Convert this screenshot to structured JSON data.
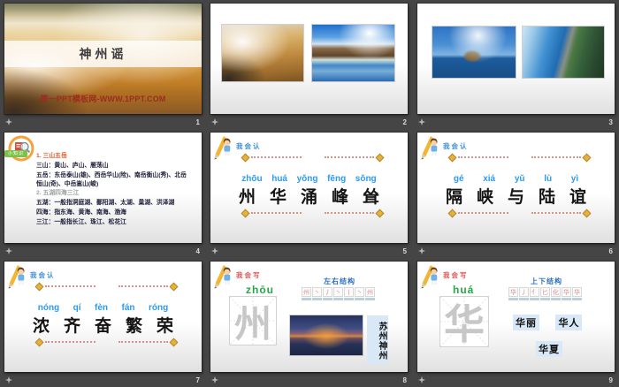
{
  "app": {
    "view": "slide-sorter"
  },
  "colors": {
    "canvas_gray": "#454545",
    "accent_blue": "#2b9bf0",
    "structure_blue": "#2a6fc0",
    "pinyin_green": "#2aa54a",
    "write_red": "#e05656",
    "read_blue": "#3b8ed8",
    "heading_orange": "#e2571f",
    "watermark_red": "#9b2d20",
    "tag_blue_bg": "#d9e8f6",
    "badge_green": "#7cc24a",
    "pushpin_gold": "#e5b23a"
  },
  "slides": [
    {
      "number": "1",
      "title": "神州谣",
      "watermark": "第一PPT模板网-WWW.1PPT.COM"
    },
    {
      "number": "2"
    },
    {
      "number": "3"
    },
    {
      "number": "4",
      "badge": "小知识",
      "lines": [
        {
          "style": "orange",
          "text": "1. 三山五岳"
        },
        {
          "style": "body",
          "text": "三山：黄山、庐山、雁荡山"
        },
        {
          "style": "body",
          "text": "五岳：东岳泰山(雄)、西岳华山(险)、南岳衡山(秀)、北岳恒山(奇)、中岳嵩山(峻)"
        },
        {
          "style": "gray",
          "text": "2. 五湖四海三江"
        },
        {
          "style": "body",
          "text": "五湖：一般指洞庭湖、鄱阳湖、太湖、巢湖、洪泽湖"
        },
        {
          "style": "body",
          "text": "四海：指东海、黄海、南海、渤海"
        },
        {
          "style": "body",
          "text": "三江：一般指长江、珠江、松花江"
        }
      ]
    },
    {
      "number": "5",
      "header": "我会认",
      "pinyin": [
        "zhōu",
        "huá",
        "yǒng",
        "fēng",
        "sǒng"
      ],
      "chars": [
        "州",
        "华",
        "涌",
        "峰",
        "耸"
      ]
    },
    {
      "number": "6",
      "header": "我会认",
      "pinyin": [
        "gé",
        "xiá",
        "yǔ",
        "lù",
        "yì"
      ],
      "chars": [
        "隔",
        "峡",
        "与",
        "陆",
        "谊"
      ]
    },
    {
      "number": "7",
      "header": "我会认",
      "pinyin": [
        "nóng",
        "qí",
        "fèn",
        "fán",
        "róng"
      ],
      "chars": [
        "浓",
        "齐",
        "奋",
        "繁",
        "荣"
      ]
    },
    {
      "number": "8",
      "header": "我会写",
      "pinyin": "zhōu",
      "character": "州",
      "structure": "左右结构",
      "strokes": [
        "州",
        "丶",
        "丿",
        "丶",
        "丨",
        "丶",
        "州"
      ],
      "words": [
        "苏州",
        "神州"
      ]
    },
    {
      "number": "9",
      "header": "我会写",
      "pinyin": "huá",
      "character": "华",
      "structure": "上下结构",
      "strokes": [
        "华",
        "丿",
        "亻",
        "匕",
        "化",
        "华",
        "华"
      ],
      "words": [
        "华丽",
        "华人",
        "华夏"
      ]
    }
  ]
}
